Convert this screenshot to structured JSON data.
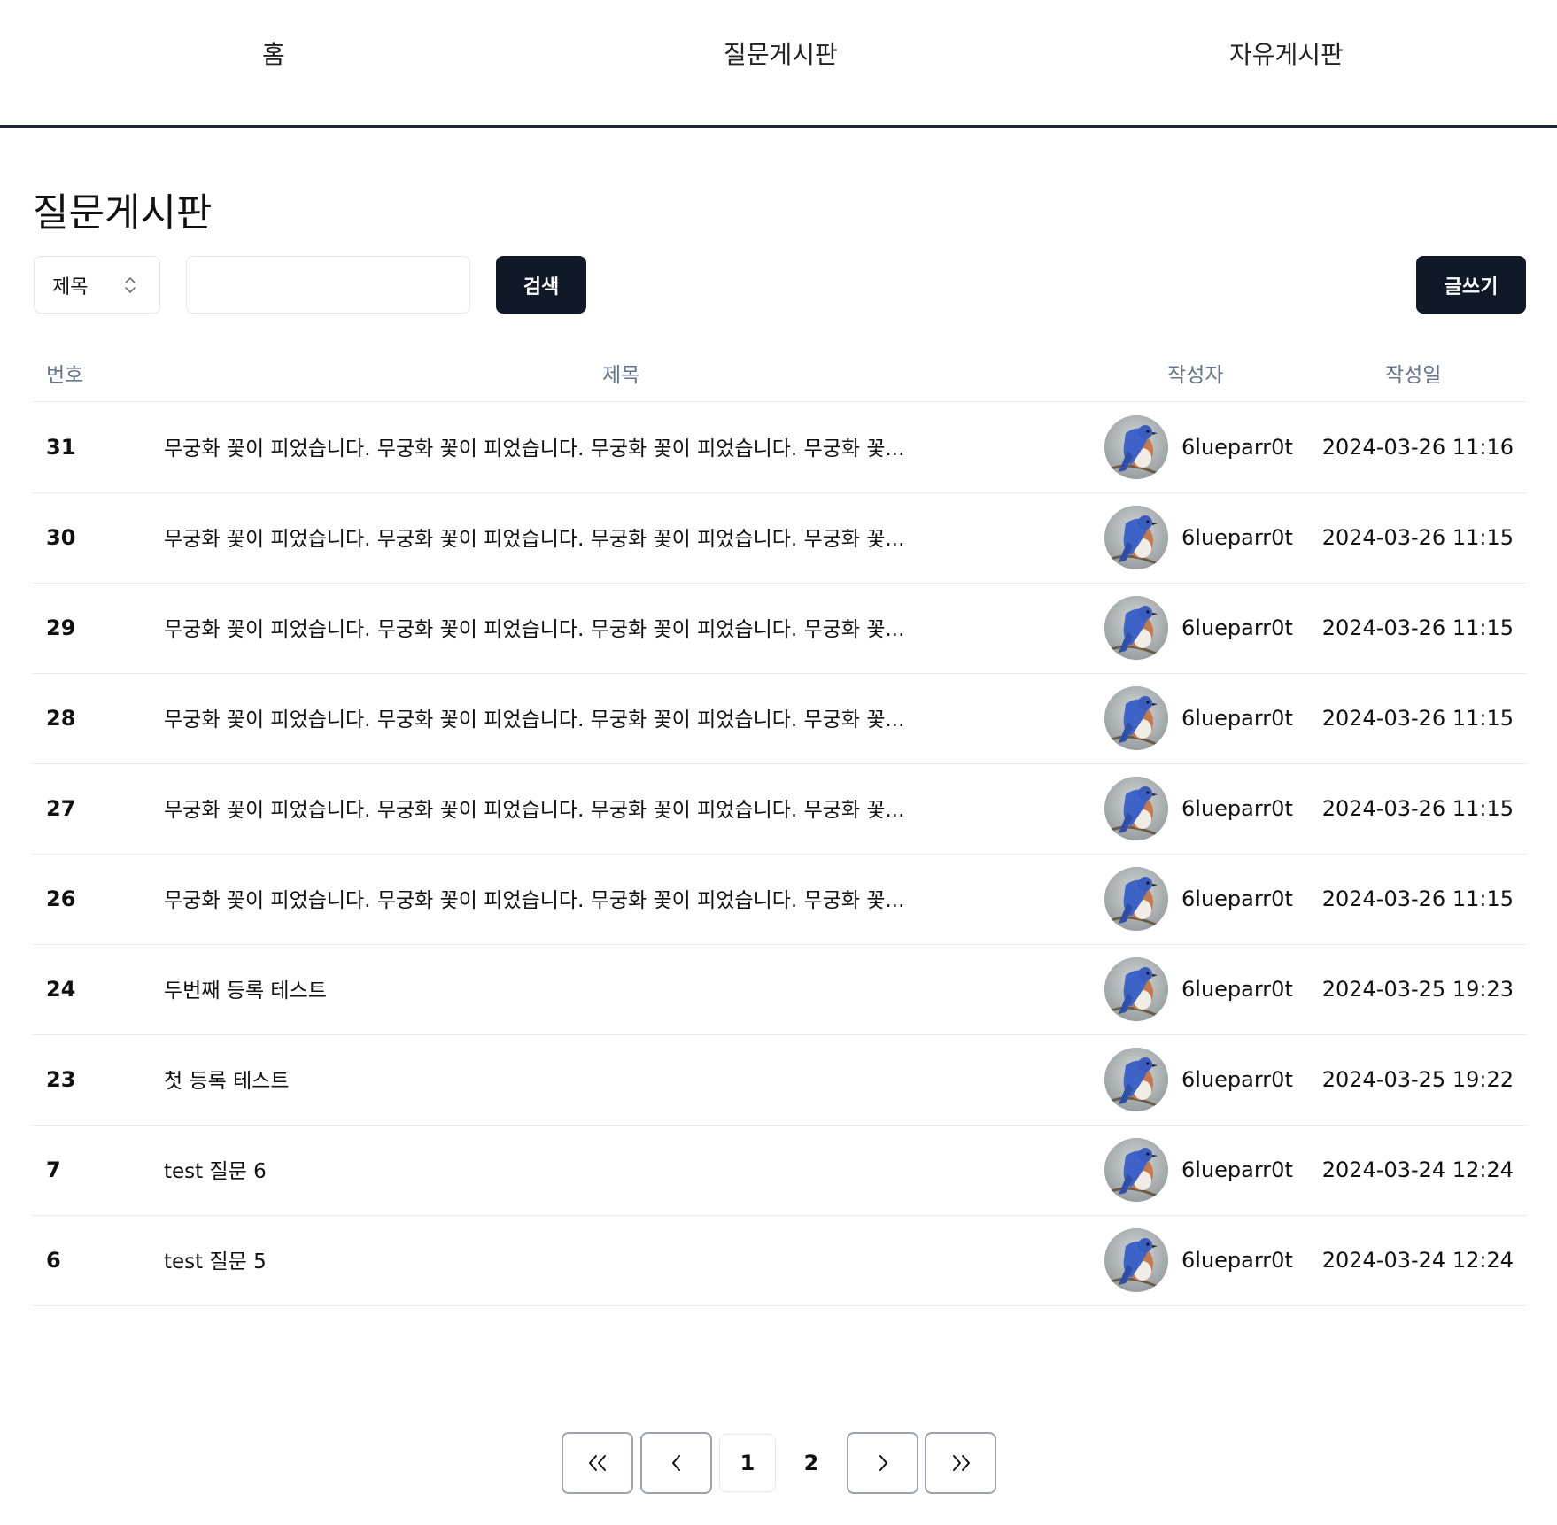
{
  "nav": {
    "home": "홈",
    "qna": "질문게시판",
    "free": "자유게시판"
  },
  "page_title": "질문게시판",
  "search": {
    "filter_selected": "제목",
    "input_value": "",
    "placeholder": "",
    "search_label": "검색",
    "write_label": "글쓰기"
  },
  "table": {
    "headers": {
      "num": "번호",
      "title": "제목",
      "author": "작성자",
      "date": "작성일"
    },
    "rows": [
      {
        "num": "31",
        "title": "무궁화 꽃이 피었습니다. 무궁화 꽃이 피었습니다. 무궁화 꽃이 피었습니다. 무궁화 꽃...",
        "author": "6lueparr0t",
        "date": "2024-03-26 11:16"
      },
      {
        "num": "30",
        "title": "무궁화 꽃이 피었습니다. 무궁화 꽃이 피었습니다. 무궁화 꽃이 피었습니다. 무궁화 꽃...",
        "author": "6lueparr0t",
        "date": "2024-03-26 11:15"
      },
      {
        "num": "29",
        "title": "무궁화 꽃이 피었습니다. 무궁화 꽃이 피었습니다. 무궁화 꽃이 피었습니다. 무궁화 꽃...",
        "author": "6lueparr0t",
        "date": "2024-03-26 11:15"
      },
      {
        "num": "28",
        "title": "무궁화 꽃이 피었습니다. 무궁화 꽃이 피었습니다. 무궁화 꽃이 피었습니다. 무궁화 꽃...",
        "author": "6lueparr0t",
        "date": "2024-03-26 11:15"
      },
      {
        "num": "27",
        "title": "무궁화 꽃이 피었습니다. 무궁화 꽃이 피었습니다. 무궁화 꽃이 피었습니다. 무궁화 꽃...",
        "author": "6lueparr0t",
        "date": "2024-03-26 11:15"
      },
      {
        "num": "26",
        "title": "무궁화 꽃이 피었습니다. 무궁화 꽃이 피었습니다. 무궁화 꽃이 피었습니다. 무궁화 꽃...",
        "author": "6lueparr0t",
        "date": "2024-03-26 11:15"
      },
      {
        "num": "24",
        "title": "두번째 등록 테스트",
        "author": "6lueparr0t",
        "date": "2024-03-25 19:23"
      },
      {
        "num": "23",
        "title": "첫 등록 테스트",
        "author": "6lueparr0t",
        "date": "2024-03-25 19:22"
      },
      {
        "num": "7",
        "title": "test 질문 6",
        "author": "6lueparr0t",
        "date": "2024-03-24 12:24"
      },
      {
        "num": "6",
        "title": "test 질문 5",
        "author": "6lueparr0t",
        "date": "2024-03-24 12:24"
      }
    ]
  },
  "pagination": {
    "pages": [
      "1",
      "2"
    ],
    "current": "1",
    "icons": [
      "double-chevron-left-icon",
      "chevron-left-icon",
      "chevron-right-icon",
      "double-chevron-right-icon"
    ]
  },
  "colors": {
    "primary_button": "#111827",
    "nav_border": "#1f2533",
    "header_text": "#64748b",
    "divider": "#e5e7eb"
  }
}
